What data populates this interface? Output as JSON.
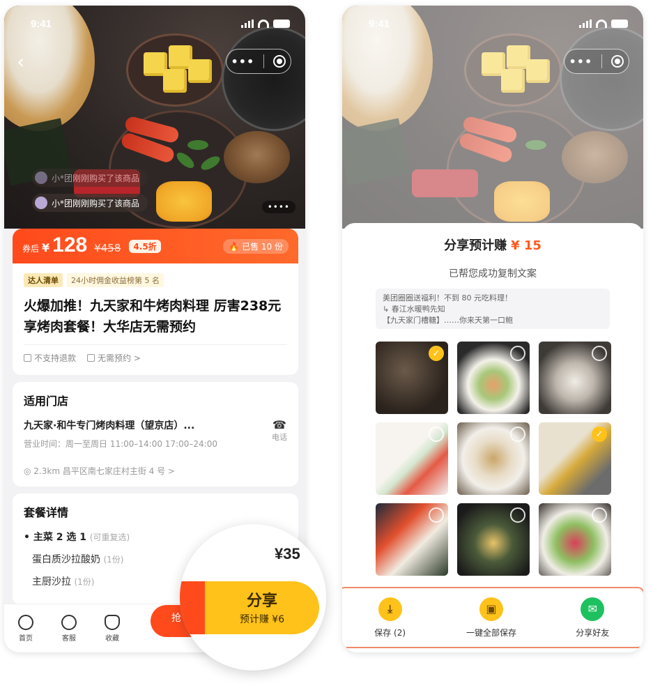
{
  "status_bar": {
    "time": "9:41"
  },
  "left": {
    "buyer_pills": [
      "小*团刚刚购买了该商品",
      "小*团刚刚购买了该商品"
    ],
    "price_bar": {
      "tag": "券后",
      "currency": "¥",
      "price": "128",
      "original": "¥458",
      "discount": "4.5折",
      "sold": "已售 10 份"
    },
    "rank": {
      "badge": "达人清单",
      "text": "24小时佣金收益榜第 5 名"
    },
    "title": "火爆加推！九天家和牛烤肉料理 厉害238元享烤肉套餐！大华店无需预约",
    "policies": [
      "不支持退款",
      "无需预约 >"
    ],
    "store": {
      "section_title": "适用门店",
      "name": "九天家·和牛专门烤肉料理（望京店）...",
      "hours": "营业时间：周一至周日 11:00–14:00 17:00–24:00",
      "phone_label": "电话",
      "address": "2.3km  昌平区南七家庄村主街 4 号 >"
    },
    "package": {
      "section_title": "套餐详情",
      "line": "主菜 2 选 1",
      "line_note": "(可重复选)",
      "items": [
        {
          "name": "蛋白质沙拉酸奶",
          "note": "(1份)"
        },
        {
          "name": "主厨沙拉",
          "note": "(1份)"
        }
      ]
    },
    "bottom_nav": [
      "首页",
      "客服",
      "收藏"
    ],
    "buy_stub": "抢"
  },
  "magnifier": {
    "price": "¥35",
    "share_label": "分享",
    "share_earn": "预计赚 ¥6"
  },
  "right": {
    "sheet_title": "分享预计赚",
    "sheet_amount": "¥ 15",
    "sheet_sub": "已帮您成功复制文案",
    "copy_lines": [
      "美团圈圈送福利！不到 80 元吃料理！",
      "春江水暖鸭先知",
      "【九天家门槽糖】……你来天第一口鲍"
    ],
    "thumbs_checked": [
      true,
      false,
      false,
      false,
      false,
      true,
      false,
      false,
      false
    ],
    "actions": [
      "保存 (2)",
      "一键全部保存",
      "分享好友"
    ]
  }
}
